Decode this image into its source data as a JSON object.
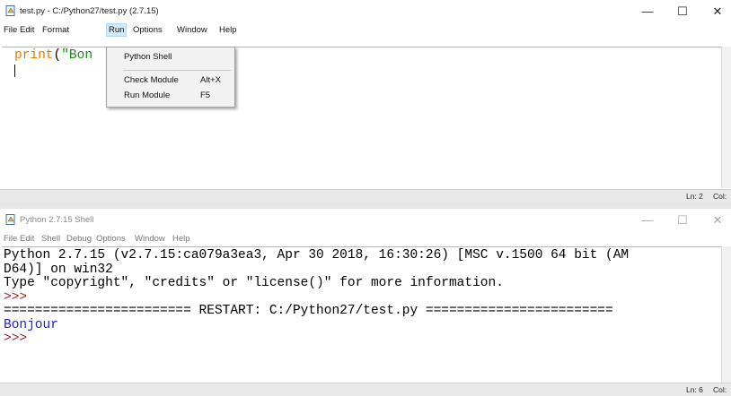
{
  "editor": {
    "title": "test.py - C:/Python27/test.py (2.7.15)",
    "controls": {
      "minimize": "—",
      "maximize": "☐",
      "close": "✕"
    },
    "menu": [
      "File",
      "Edit",
      "Format",
      "Run",
      "Options",
      "Window",
      "Help"
    ],
    "code": {
      "keyword": "print",
      "paren": "(",
      "string_partial": "\"Bon"
    },
    "status": {
      "line": "Ln: 2",
      "col": "Col:"
    }
  },
  "run_menu": {
    "items": [
      {
        "label": "Python Shell",
        "accel": ""
      },
      {
        "label": "Check Module",
        "accel": "Alt+X"
      },
      {
        "label": "Run Module",
        "accel": "F5"
      }
    ]
  },
  "shell": {
    "title": "Python 2.7.15 Shell",
    "controls": {
      "minimize": "—",
      "maximize": "☐",
      "close": "✕"
    },
    "menu": [
      "File",
      "Edit",
      "Shell",
      "Debug",
      "Options",
      "Window",
      "Help"
    ],
    "lines": {
      "banner1": "Python 2.7.15 (v2.7.15:ca079a3ea3, Apr 30 2018, 16:30:26) [MSC v.1500 64 bit (AM",
      "banner2": "D64)] on win32",
      "banner3": "Type \"copyright\", \"credits\" or \"license()\" for more information.",
      "prompt1": ">>>",
      "restart": "======================== RESTART: C:/Python27/test.py ========================",
      "output": "Bonjour",
      "prompt2": ">>>"
    },
    "status": {
      "line": "Ln: 6",
      "col": "Col:"
    }
  }
}
